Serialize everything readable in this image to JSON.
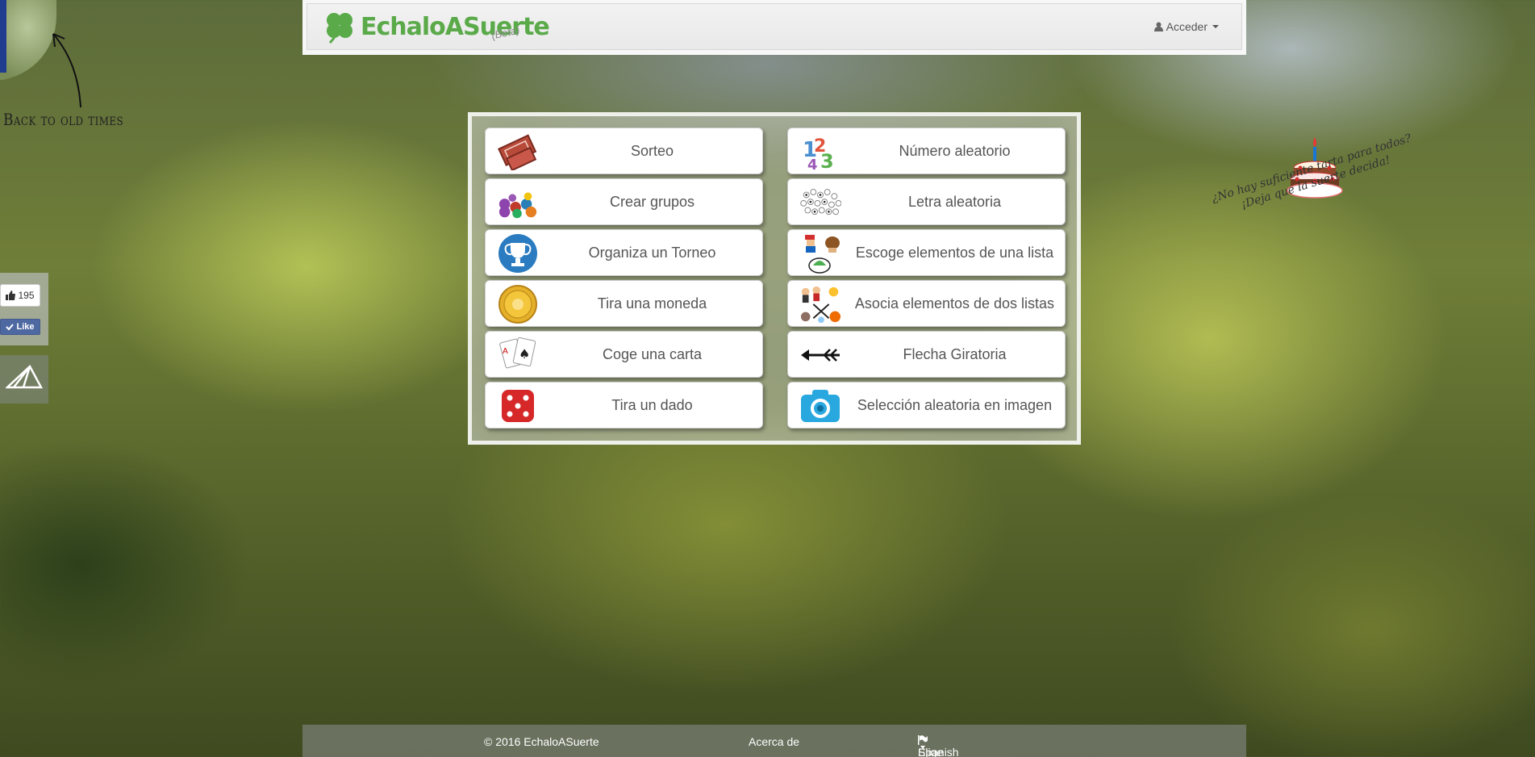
{
  "corner": {
    "back_text": "Back to old times"
  },
  "navbar": {
    "brand_name": "EchaloASuerte",
    "brand_badge": "(Beta)",
    "login_label": "Acceder"
  },
  "tiles": [
    {
      "label": "Sorteo",
      "icon": "ticket-icon"
    },
    {
      "label": "Número aleatorio",
      "icon": "numbers-icon"
    },
    {
      "label": "Crear grupos",
      "icon": "groups-icon"
    },
    {
      "label": "Letra aleatoria",
      "icon": "letters-icon"
    },
    {
      "label": "Organiza un Torneo",
      "icon": "trophy-icon"
    },
    {
      "label": "Escoge elementos de una lista",
      "icon": "characters-icon"
    },
    {
      "label": "Tira una moneda",
      "icon": "coin-icon"
    },
    {
      "label": "Asocia elementos de dos listas",
      "icon": "associate-icon"
    },
    {
      "label": "Coge una carta",
      "icon": "cards-icon"
    },
    {
      "label": "Flecha Giratoria",
      "icon": "arrow-icon"
    },
    {
      "label": "Tira un dado",
      "icon": "dice-icon"
    },
    {
      "label": "Selección aleatoria en imagen",
      "icon": "camera-icon"
    }
  ],
  "cake": {
    "line1": "¿No hay suficiente tarta para todos?",
    "line2": "¡Deja que la suerte decida!"
  },
  "social": {
    "like_count": "195",
    "like_label": "Like"
  },
  "footer": {
    "copyright": "© 2016 EchaloASuerte",
    "about": "Acerca de",
    "language_prompt": "Elige un idioma:",
    "language_value": "Spanish"
  },
  "colors": {
    "brand_green": "#5aaa4a",
    "facebook_blue": "#4e69a2"
  }
}
